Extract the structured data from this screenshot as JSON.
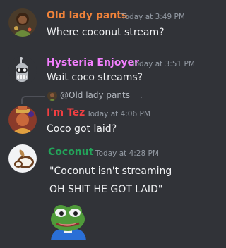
{
  "messages": [
    {
      "username": "Old lady pants",
      "timestamp": "Today at 3:49 PM",
      "lines": [
        "Where coconut stream?"
      ],
      "name_color": "#f0833a"
    },
    {
      "username": "Hysteria Enjoyer",
      "timestamp": "Today at 3:51 PM",
      "lines": [
        "Wait coco streams?"
      ],
      "name_color": "#f47fff"
    },
    {
      "reply_to": "@Old lady pants",
      "reply_suffix": ".",
      "username": "I'm Tez",
      "timestamp": "Today at 4:06 PM",
      "lines": [
        "Coco got laid?"
      ],
      "name_color": "#f23f42"
    },
    {
      "username": "Coconut",
      "timestamp": "Today at 4:28 PM",
      "lines": [
        "\"Coconut isn't streaming",
        "OH SHIT HE GOT LAID\""
      ],
      "name_color": "#23a55a",
      "emoji": "pepe-emoji"
    }
  ],
  "colors": {
    "background": "#313338",
    "timestamp": "#949ba4",
    "message_text": "#f2f3f5"
  }
}
